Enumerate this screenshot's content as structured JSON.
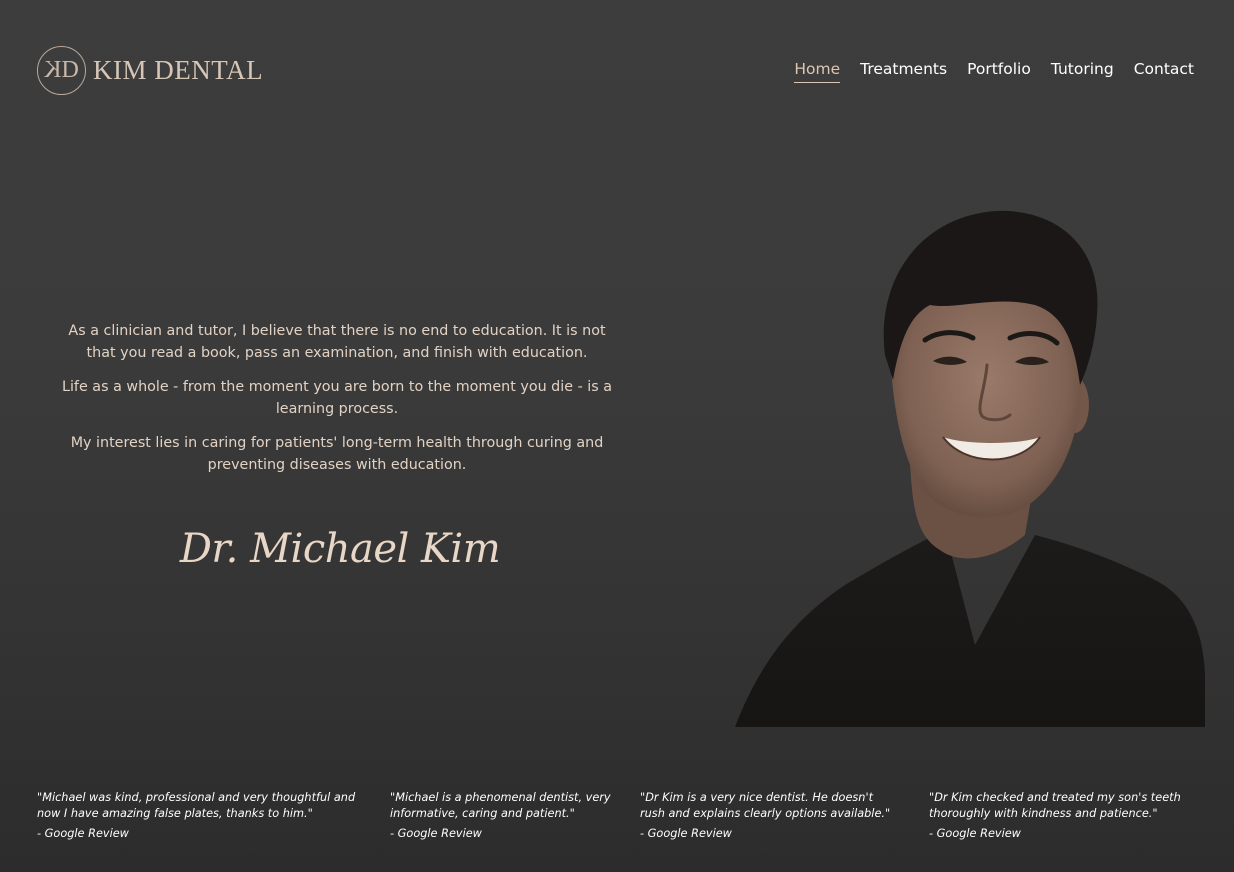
{
  "logo": {
    "mark": "KD",
    "text": "KIM DENTAL"
  },
  "nav": [
    {
      "label": "Home",
      "active": true
    },
    {
      "label": "Treatments"
    },
    {
      "label": "Portfolio"
    },
    {
      "label": "Tutoring"
    },
    {
      "label": "Contact"
    }
  ],
  "hero": {
    "paragraphs": [
      "As a clinician and tutor, I believe that there is no end to education. It is not that you read a book, pass an examination, and finish with education.",
      "Life as a whole - from the moment you are born to the moment you die - is a learning process.",
      "My interest lies in caring for patients' long-term health through curing and preventing diseases with education."
    ],
    "signature": "Dr. Michael Kim"
  },
  "reviews": [
    {
      "quote": "\"Michael was kind, professional and very thoughtful and now I have amazing false plates, thanks to him.\"",
      "source": "- Google Review"
    },
    {
      "quote": "\"Michael is a phenomenal dentist, very informative, caring and patient.\"",
      "source": "- Google Review"
    },
    {
      "quote": "\"Dr Kim is a very nice dentist. He doesn't rush and explains clearly options available.\"",
      "source": "- Google Review"
    },
    {
      "quote": "\"Dr Kim checked and treated my son's teeth thoroughly with kindness and patience.\"",
      "source": "- Google Review"
    }
  ],
  "colors": {
    "accent": "#dcc6b4",
    "background": "#3b3b3b",
    "text": "#e2d2c4"
  }
}
